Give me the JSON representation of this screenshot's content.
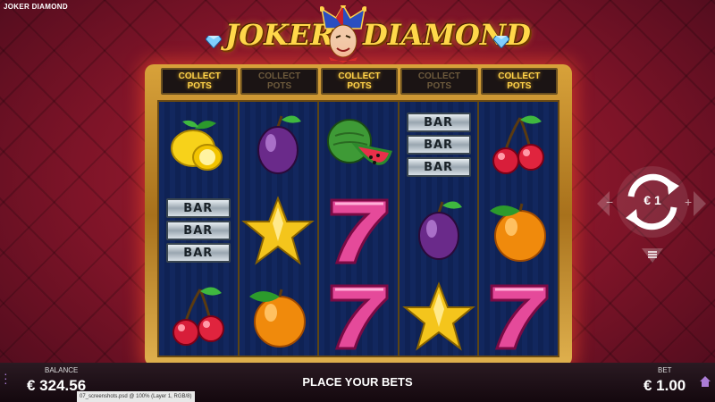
{
  "window": {
    "title": "JOKER DIAMOND"
  },
  "logo": {
    "left_word": "JOKER",
    "right_word": "DIAMOND"
  },
  "collect_pots": [
    {
      "label": "COLLECT\nPOTS",
      "active": true
    },
    {
      "label": "COLLECT\nPOTS",
      "active": false
    },
    {
      "label": "COLLECT\nPOTS",
      "active": true
    },
    {
      "label": "COLLECT\nPOTS",
      "active": false
    },
    {
      "label": "COLLECT\nPOTS",
      "active": true
    }
  ],
  "reels": [
    [
      "lemon",
      "bar3",
      "cherry"
    ],
    [
      "plum",
      "star",
      "orange"
    ],
    [
      "melon",
      "seven",
      "seven"
    ],
    [
      "bar3",
      "plum",
      "star"
    ],
    [
      "cherry",
      "orange",
      "seven"
    ]
  ],
  "symbols": {
    "bar_text": "BAR"
  },
  "spin": {
    "bet_text": "€ 1"
  },
  "bottom_bar": {
    "balance_label": "BALANCE",
    "balance_value": "€ 324.56",
    "status": "PLACE YOUR BETS",
    "bet_label": "BET",
    "bet_value": "€ 1.00"
  },
  "tooltip": "07_screenshots.psd @ 100% (Layer 1, RGB/8)",
  "colors": {
    "gold": "#ffd34a",
    "background": "#7e1428",
    "reel_bg": "#12275e",
    "accent_purple": "#ab7cd6"
  }
}
